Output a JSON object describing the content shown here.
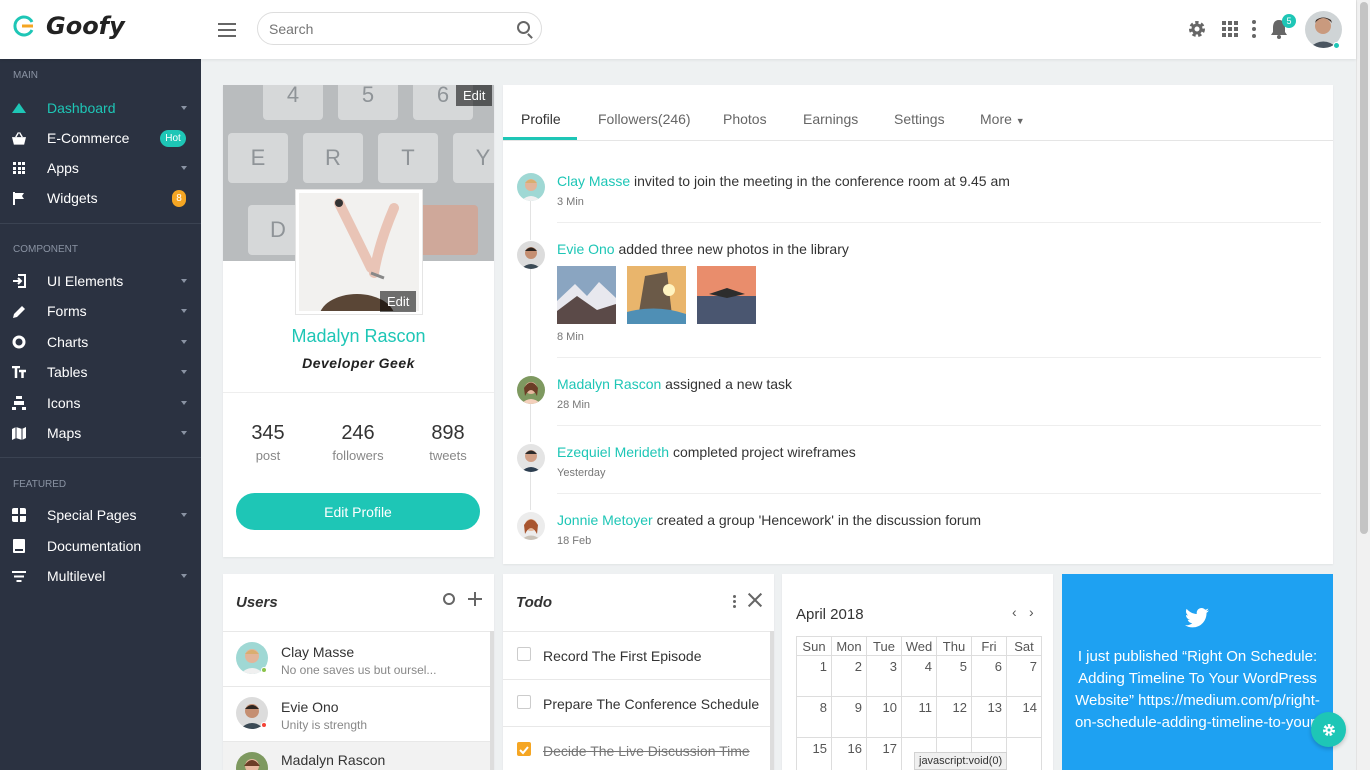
{
  "app": {
    "name": "Goofy"
  },
  "header": {
    "search_placeholder": "Search",
    "notif_count": "5"
  },
  "sidebar": {
    "sections": [
      {
        "title": "MAIN",
        "items": [
          {
            "label": "Dashboard",
            "icon": "dashboard-icon"
          },
          {
            "label": "E-Commerce",
            "icon": "basket-icon",
            "badge": "Hot"
          },
          {
            "label": "Apps",
            "icon": "apps-icon"
          },
          {
            "label": "Widgets",
            "icon": "flag-icon",
            "badge": "8"
          }
        ]
      },
      {
        "title": "COMPONENT",
        "items": [
          {
            "label": "UI Elements",
            "icon": "login-icon"
          },
          {
            "label": "Forms",
            "icon": "pencil-icon"
          },
          {
            "label": "Charts",
            "icon": "donut-icon"
          },
          {
            "label": "Tables",
            "icon": "text-icon"
          },
          {
            "label": "Icons",
            "icon": "icons-icon"
          },
          {
            "label": "Maps",
            "icon": "map-icon"
          }
        ]
      },
      {
        "title": "FEATURED",
        "items": [
          {
            "label": "Special Pages",
            "icon": "pages-icon"
          },
          {
            "label": "Documentation",
            "icon": "book-icon"
          },
          {
            "label": "Multilevel",
            "icon": "filter-icon"
          }
        ]
      }
    ]
  },
  "profile": {
    "edit_cover": "Edit",
    "edit_pic": "Edit",
    "name": "Madalyn Rascon",
    "role": "Developer Geek",
    "stats": [
      {
        "num": "345",
        "label": "post"
      },
      {
        "num": "246",
        "label": "followers"
      },
      {
        "num": "898",
        "label": "tweets"
      }
    ],
    "edit_button": "Edit Profile"
  },
  "tabs": [
    "Profile",
    "Followers(246)",
    "Photos",
    "Earnings",
    "Settings",
    "More"
  ],
  "activity": [
    {
      "name": "Clay Masse",
      "text": "invited to join the meeting in the conference room at 9.45 am",
      "time": "3 Min"
    },
    {
      "name": "Evie Ono",
      "text": "added three new photos in the library",
      "time": "8 Min"
    },
    {
      "name": "Madalyn Rascon",
      "text": "assigned a new task",
      "time": "28 Min"
    },
    {
      "name": "Ezequiel Merideth",
      "text": "completed project wireframes",
      "time": "Yesterday"
    },
    {
      "name": "Jonnie Metoyer",
      "text": "created a group 'Hencework' in the discussion forum",
      "time": "18 Feb"
    }
  ],
  "users": {
    "title": "Users",
    "list": [
      {
        "name": "Clay Masse",
        "status": "No one saves us but oursel..."
      },
      {
        "name": "Evie Ono",
        "status": "Unity is strength"
      },
      {
        "name": "Madalyn Rascon",
        "status": ""
      }
    ]
  },
  "todo": {
    "title": "Todo",
    "items": [
      {
        "label": "Record The First Episode",
        "done": false
      },
      {
        "label": "Prepare The Conference Schedule",
        "done": false
      },
      {
        "label": "Decide The Live Discussion Time",
        "done": true
      }
    ]
  },
  "calendar": {
    "title": "April 2018",
    "days": [
      "Sun",
      "Mon",
      "Tue",
      "Wed",
      "Thu",
      "Fri",
      "Sat"
    ],
    "weeks": [
      [
        "1",
        "2",
        "3",
        "4",
        "5",
        "6",
        "7"
      ],
      [
        "8",
        "9",
        "10",
        "11",
        "12",
        "13",
        "14"
      ],
      [
        "15",
        "16",
        "17",
        "",
        "",
        "",
        ""
      ]
    ]
  },
  "twitter": {
    "text": "I just published “Right On Schedule: Adding Timeline To Your WordPress Website” https://medium.com/p/right-on-schedule-adding-timeline-to-your-"
  },
  "statusbar": {
    "url": "javascript:void(0)"
  },
  "colors": {
    "accent": "#1ec6b6",
    "sidebar": "#2b3241",
    "twitter": "#1ea1f2",
    "warning": "#f5a623"
  }
}
